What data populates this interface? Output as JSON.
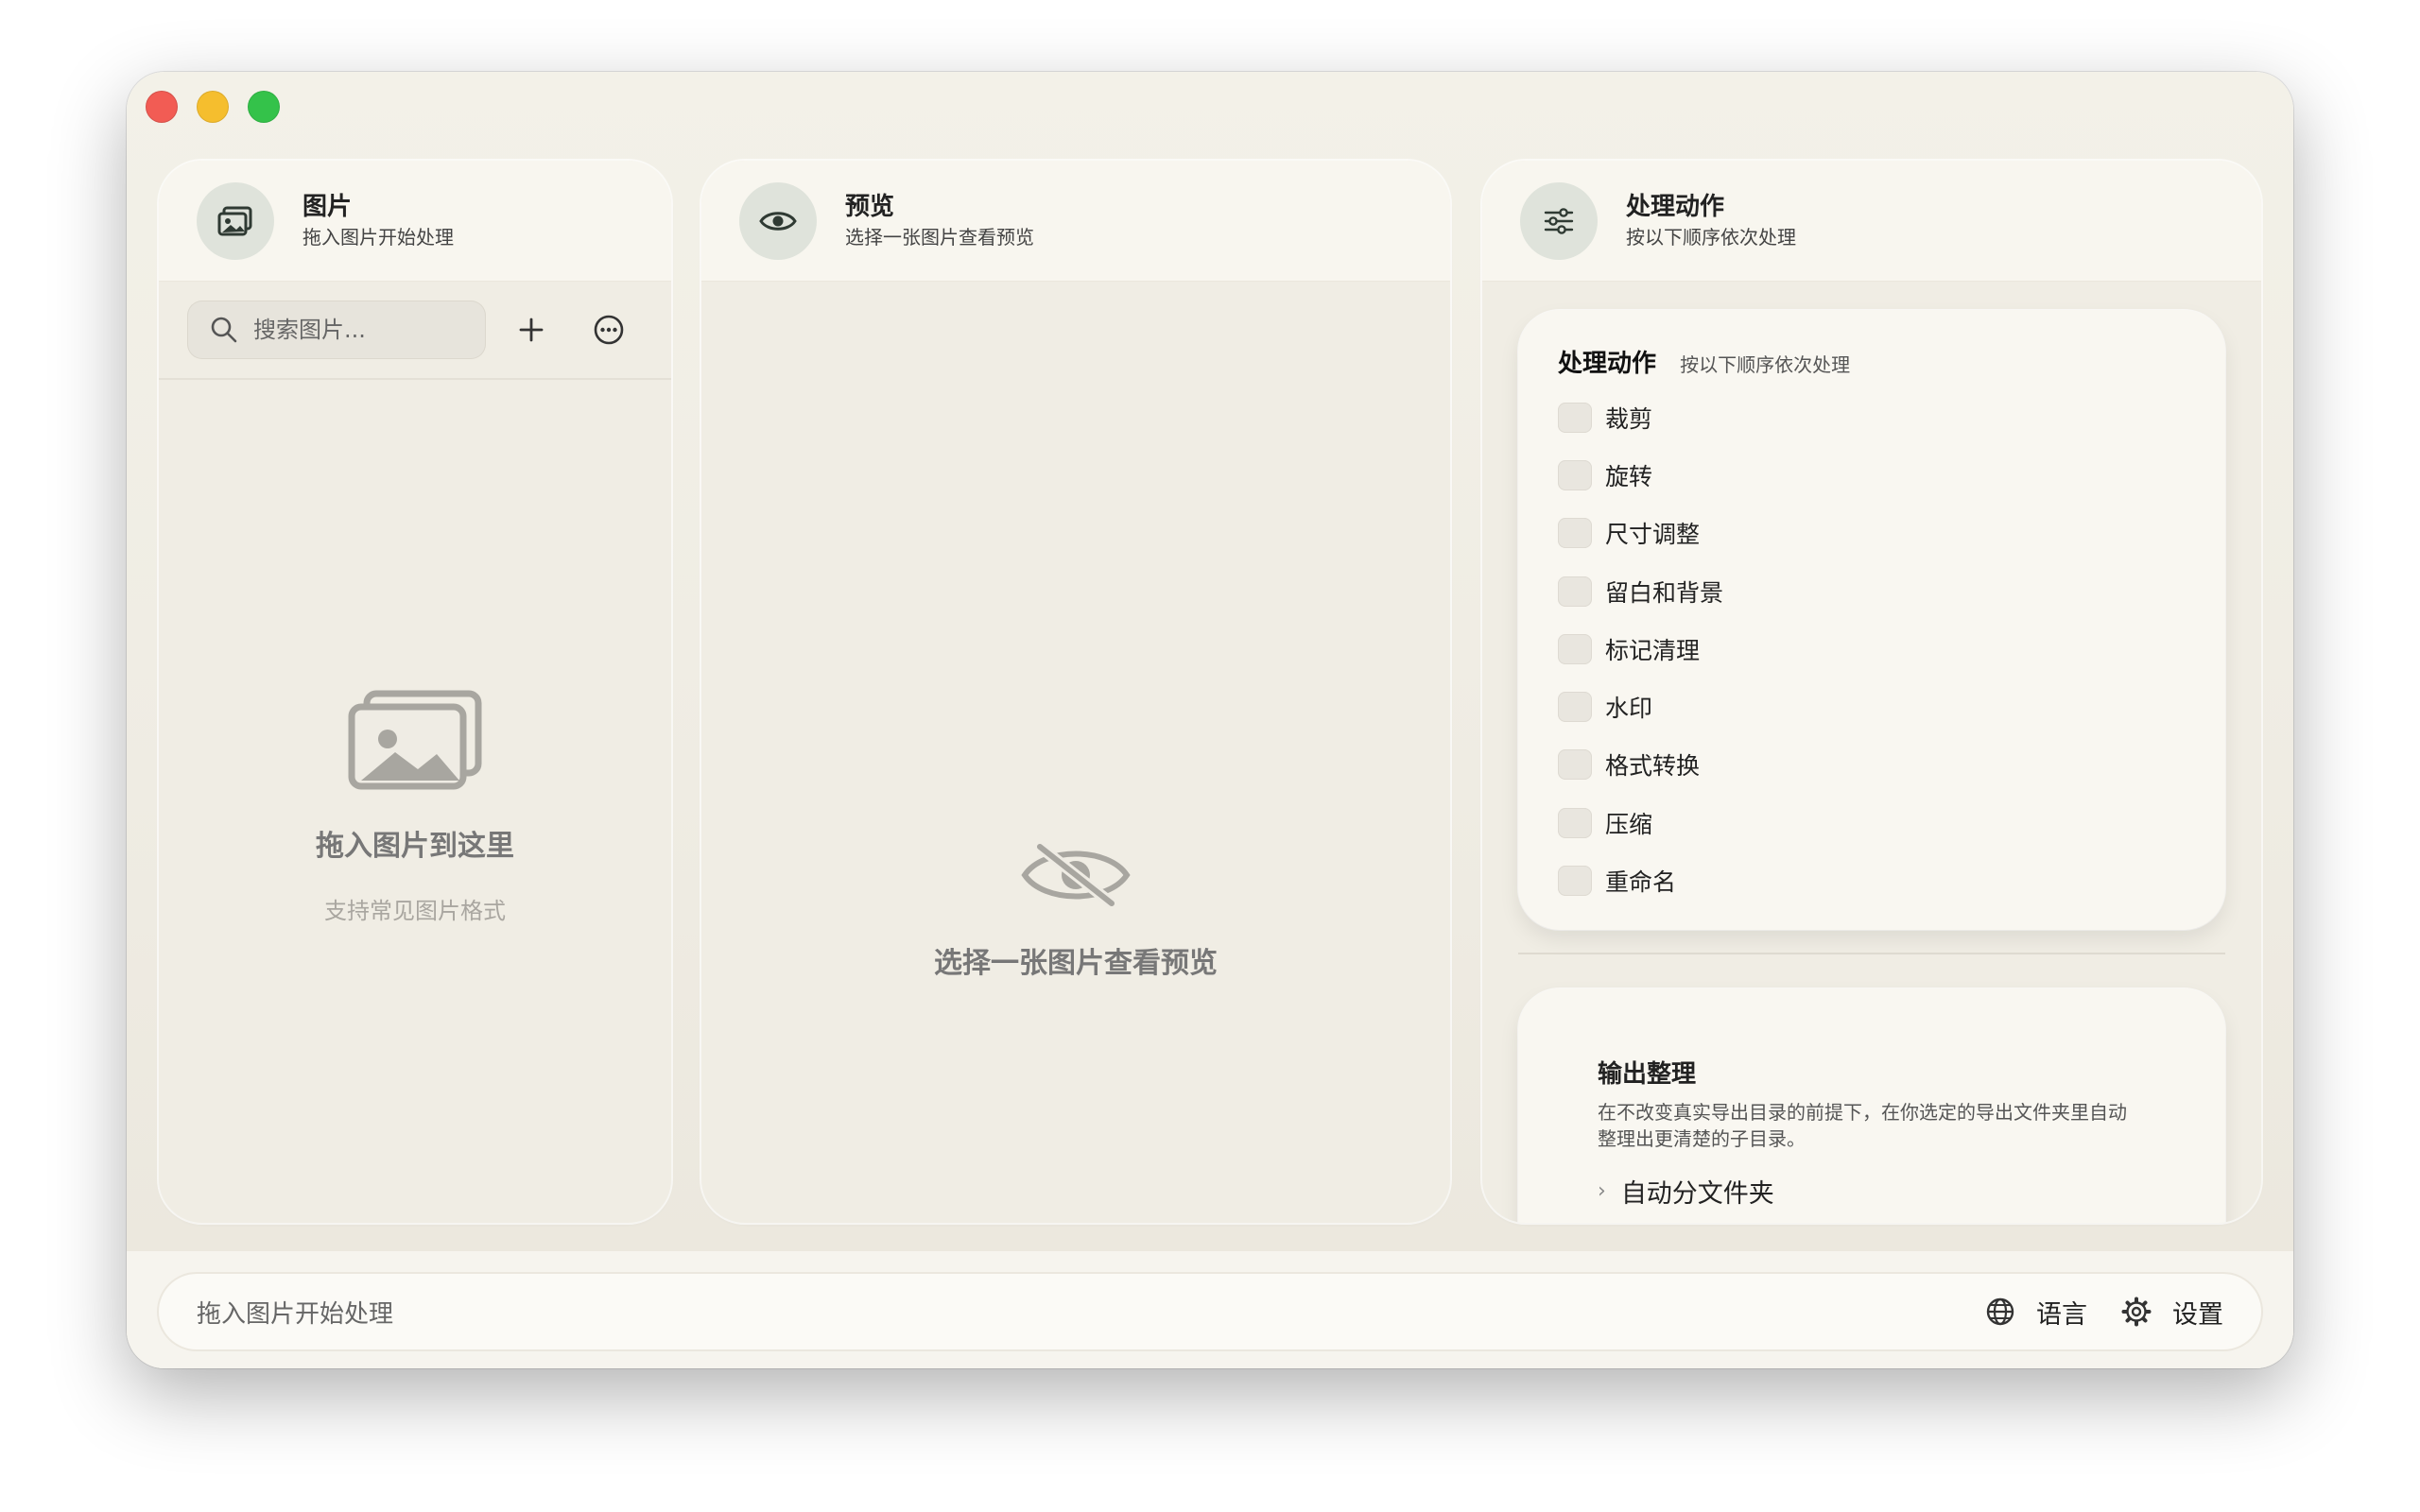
{
  "left_panel": {
    "title": "图片",
    "subtitle": "拖入图片开始处理",
    "search_placeholder": "搜索图片...",
    "empty_title": "拖入图片到这里",
    "empty_subtitle": "支持常见图片格式"
  },
  "middle_panel": {
    "title": "预览",
    "subtitle": "选择一张图片查看预览",
    "empty_text": "选择一张图片查看预览"
  },
  "right_panel": {
    "title": "处理动作",
    "subtitle": "按以下顺序依次处理",
    "actions_card": {
      "title": "处理动作",
      "subtitle": "按以下顺序依次处理",
      "items": [
        "裁剪",
        "旋转",
        "尺寸调整",
        "留白和背景",
        "标记清理",
        "水印",
        "格式转换",
        "压缩",
        "重命名"
      ]
    },
    "output_card": {
      "title": "输出整理",
      "description": "在不改变真实导出目录的前提下，在你选定的导出文件夹里自动整理出更清楚的子目录。",
      "subsection": "自动分文件夹"
    }
  },
  "status_bar": {
    "text": "拖入图片开始处理",
    "language_label": "语言",
    "settings_label": "设置"
  }
}
